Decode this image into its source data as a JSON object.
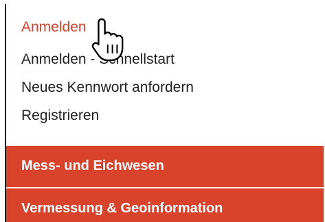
{
  "menu": {
    "items": [
      {
        "label": "Anmelden",
        "active": true
      },
      {
        "label": "Anmelden - Schnellstart",
        "active": false
      },
      {
        "label": "Neues Kennwort anfordern",
        "active": false
      },
      {
        "label": "Registrieren",
        "active": false
      }
    ]
  },
  "nav": {
    "items": [
      {
        "label": "Mess- und Eichwesen"
      },
      {
        "label": "Vermessung & Geoinformation"
      }
    ]
  },
  "colors": {
    "accent": "#d9432c",
    "active_link": "#d6412b",
    "text": "#222222",
    "border": "#1e1e1e"
  },
  "cursor": {
    "icon": "hand-pointer-icon"
  }
}
